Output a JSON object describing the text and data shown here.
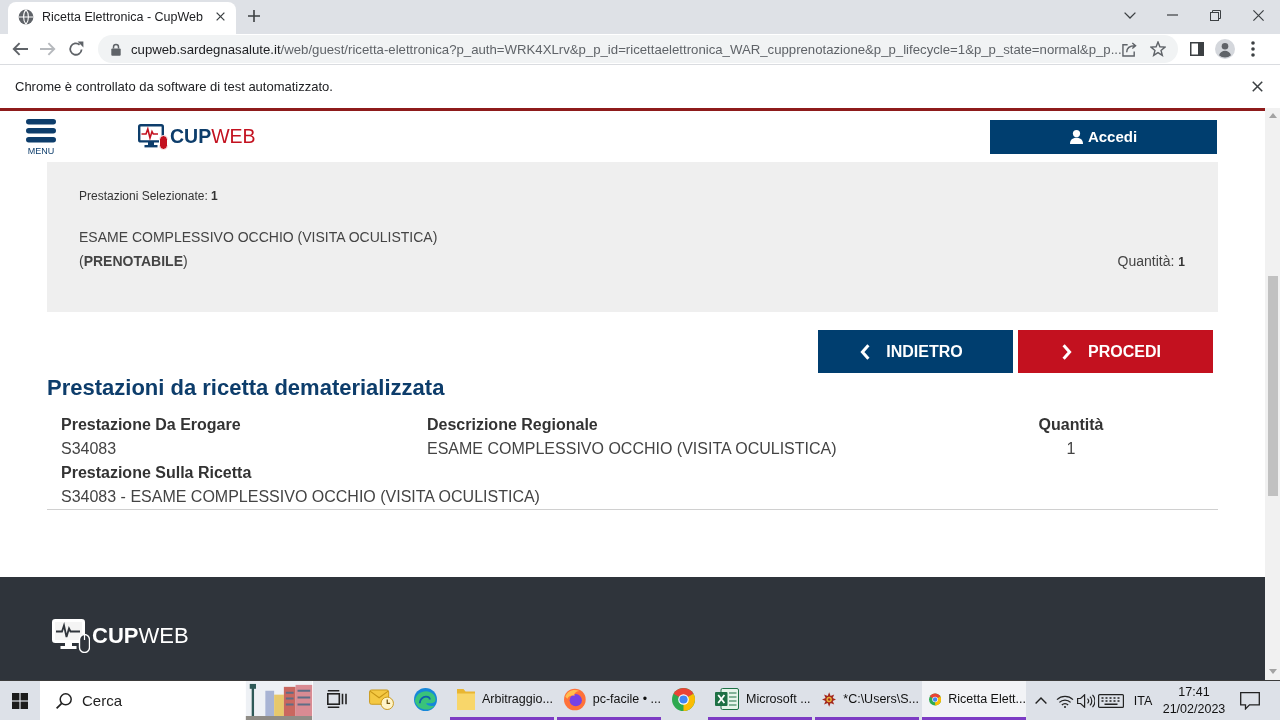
{
  "browser": {
    "tabs": [
      {
        "title": "Ricetta Elettronica - CupWeb",
        "selected": true
      }
    ],
    "url": {
      "host": "cupweb.sardegnasalute.it",
      "path": "/web/guest/ricetta-elettronica?p_auth=WRK4XLrv&p_p_id=ricettaelettronica_WAR_cupprenotazione&p_p_lifecycle=1&p_p_state=normal&p_p..."
    },
    "infobar": "Chrome è controllato da software di test automatizzato."
  },
  "header": {
    "menu_label": "MENU",
    "logo": "**CUP**WEB",
    "login_button": "Accedi"
  },
  "selection": {
    "count": "Prestazioni Selezionate: **1**",
    "service": "ESAME COMPLESSIVO OCCHIO (VISITA OCULISTICA)",
    "status": "(**PRENOTABILE**)",
    "quantity": "Quantità: **1**"
  },
  "actions": [
    {
      "label": "INDIETRO",
      "kind": "back"
    },
    {
      "label": "PROCEDI",
      "kind": "next"
    }
  ],
  "prescription": {
    "title": "Prestazioni da ricetta dematerializzata",
    "rows": [
      [
        {
          "label": "Prestazione Da Erogare",
          "value": "S34083"
        },
        {
          "label": "Descrizione Regionale",
          "value": "ESAME COMPLESSIVO OCCHIO (VISITA OCULISTICA)"
        },
        {
          "label": "Quantità",
          "value": "1"
        }
      ],
      [
        {
          "label": "Prestazione Sulla Ricetta",
          "value": "S34083 - ESAME COMPLESSIVO OCCHIO (VISITA OCULISTICA)"
        }
      ]
    ]
  },
  "footer": {
    "logo": "**CUP**WEB"
  },
  "taskbar": {
    "search": {
      "placeholder": "Cerca"
    },
    "apps": [
      {
        "kind": "taskview",
        "open": false,
        "selected": false
      },
      {
        "kind": "mail",
        "open": false,
        "selected": false
      },
      {
        "kind": "edge",
        "open": false,
        "selected": false
      },
      {
        "kind": "folder",
        "label": "Arbitraggio...",
        "open": true,
        "selected": false
      },
      {
        "kind": "firefox",
        "label": "pc-facile • ...",
        "open": true,
        "selected": false
      },
      {
        "kind": "chrome",
        "open": false,
        "selected": false
      },
      {
        "kind": "excel",
        "label": "Microsoft ...",
        "open": true,
        "selected": false
      },
      {
        "kind": "starburst",
        "label": "*C:\\Users\\S...",
        "open": true,
        "selected": false
      },
      {
        "kind": "chrome",
        "label": "Ricetta Elett...",
        "open": true,
        "selected": true
      }
    ],
    "language": "ITA",
    "time": "17:41",
    "date": "21/02/2023"
  }
}
